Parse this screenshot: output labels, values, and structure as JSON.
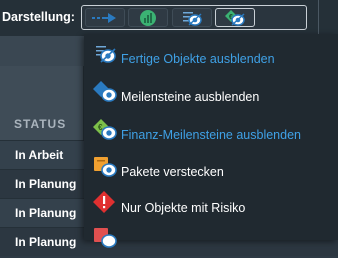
{
  "toolbar": {
    "label": "Darstellung:",
    "view_buttons": [
      {
        "icon": "gantt-arrow-icon",
        "active": false
      },
      {
        "icon": "bar-chart-icon",
        "active": false
      },
      {
        "icon": "hide-list-icon",
        "active": false
      },
      {
        "icon": "hide-finance-milestone-icon",
        "active": true
      }
    ]
  },
  "table": {
    "status_header": "STATUS",
    "rows": [
      {
        "status": "In Arbeit"
      },
      {
        "status": "In Planung"
      },
      {
        "status": "In Planung"
      },
      {
        "status": "In Planung"
      }
    ]
  },
  "menu": {
    "items": [
      {
        "label": "Fertige Objekte ausblenden",
        "icon": "hide-finished-objects-icon",
        "selected": true
      },
      {
        "label": "Meilensteine ausblenden",
        "icon": "hide-milestones-icon",
        "selected": false
      },
      {
        "label": "Finanz-Meilensteine ausblenden",
        "icon": "hide-finance-milestones-icon",
        "selected": true
      },
      {
        "label": "Pakete verstecken",
        "icon": "hide-packages-icon",
        "selected": false
      },
      {
        "label": "Nur Objekte mit Risiko",
        "icon": "risk-warning-icon",
        "selected": false
      },
      {
        "label": "",
        "icon": "partially-visible-icon",
        "selected": false
      }
    ]
  },
  "colors": {
    "selected_text": "#3fa1e6",
    "menu_background": "#202930",
    "toolbar_background": "#253038",
    "accent_blue": "#2a7ac0",
    "accent_green": "#3bb273",
    "warning_red": "#e03030",
    "package_orange": "#f0a030"
  }
}
